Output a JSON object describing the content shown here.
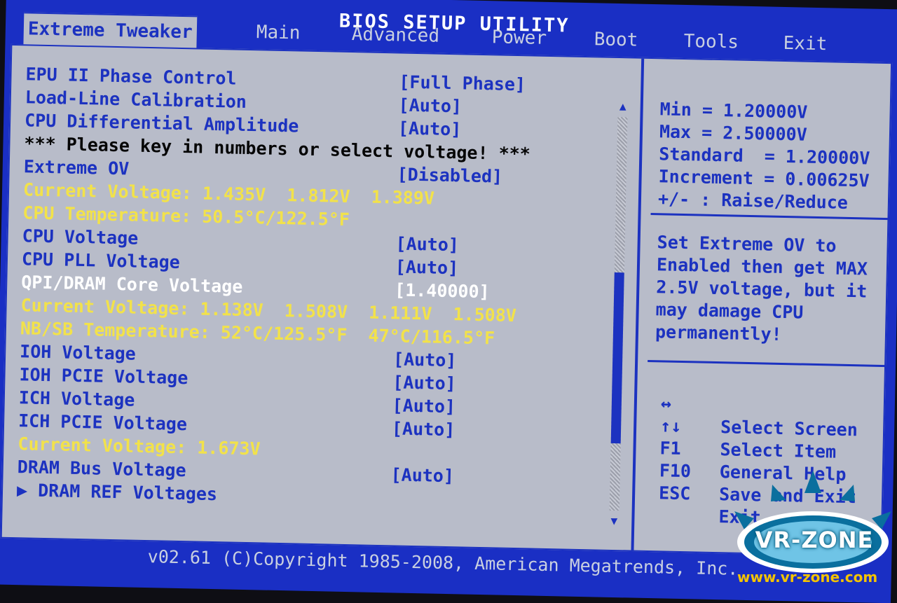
{
  "title": "BIOS SETUP UTILITY",
  "tabs": [
    {
      "label": "Extreme Tweaker",
      "active": true
    },
    {
      "label": "Main"
    },
    {
      "label": "Advanced"
    },
    {
      "label": "Power"
    },
    {
      "label": "Boot"
    },
    {
      "label": "Tools"
    },
    {
      "label": "Exit"
    }
  ],
  "settings": [
    {
      "label": "EPU II Phase Control",
      "value": "[Full Phase]"
    },
    {
      "label": "Load-Line Calibration",
      "value": "[Auto]"
    },
    {
      "label": "CPU Differential Amplitude",
      "value": "[Auto]"
    },
    {
      "label": "*** Please key in numbers or select voltage! ***",
      "value": ""
    },
    {
      "label": "Extreme OV",
      "value": "[Disabled]"
    },
    {
      "label": "Current Voltage: 1.435V  1.812V  1.389V",
      "value": ""
    },
    {
      "label": "CPU Temperature: 50.5°C/122.5°F",
      "value": ""
    },
    {
      "label": "CPU Voltage",
      "value": "[Auto]"
    },
    {
      "label": "CPU PLL Voltage",
      "value": "[Auto]"
    },
    {
      "label": "QPI/DRAM Core Voltage",
      "value": "[1.40000]"
    },
    {
      "label": "Current Voltage: 1.138V  1.508V  1.111V  1.508V",
      "value": ""
    },
    {
      "label": "NB/SB Temperature: 52°C/125.5°F  47°C/116.5°F",
      "value": ""
    },
    {
      "label": "IOH Voltage",
      "value": "[Auto]"
    },
    {
      "label": "IOH PCIE Voltage",
      "value": "[Auto]"
    },
    {
      "label": "ICH Voltage",
      "value": "[Auto]"
    },
    {
      "label": "ICH PCIE Voltage",
      "value": "[Auto]"
    },
    {
      "label": "Current Voltage: 1.673V",
      "value": ""
    },
    {
      "label": "DRAM Bus Voltage",
      "value": "[Auto]"
    },
    {
      "label": "▶ DRAM REF Voltages",
      "value": ""
    }
  ],
  "help": {
    "lines": [
      "Min = 1.20000V",
      "Max = 2.50000V",
      "Standard  = 1.20000V",
      "Increment = 0.00625V",
      "+/- : Raise/Reduce"
    ],
    "description": [
      "Set Extreme OV to",
      "Enabled then get MAX",
      "2.5V voltage, but it",
      "may damage CPU",
      "permanently!"
    ],
    "keys": [
      {
        "key": "↔",
        "desc": "Select Screen"
      },
      {
        "key": "↑↓",
        "desc": "Select Item"
      },
      {
        "key": "F1",
        "desc": "General Help"
      },
      {
        "key": "F10",
        "desc": "Save and Exit"
      },
      {
        "key": "ESC",
        "desc": "Exit"
      }
    ]
  },
  "footer": "v02.61 (C)Copyright 1985-2008, American Megatrends, Inc.",
  "watermark": {
    "logo_text": "VR-ZONE",
    "url": "www.vr-zone.com"
  },
  "colors": {
    "bios_blue": "#1c32c0",
    "panel_gray": "#b8bcc9",
    "info_yellow": "#f2e24a",
    "selected_white": "#ffffff"
  }
}
